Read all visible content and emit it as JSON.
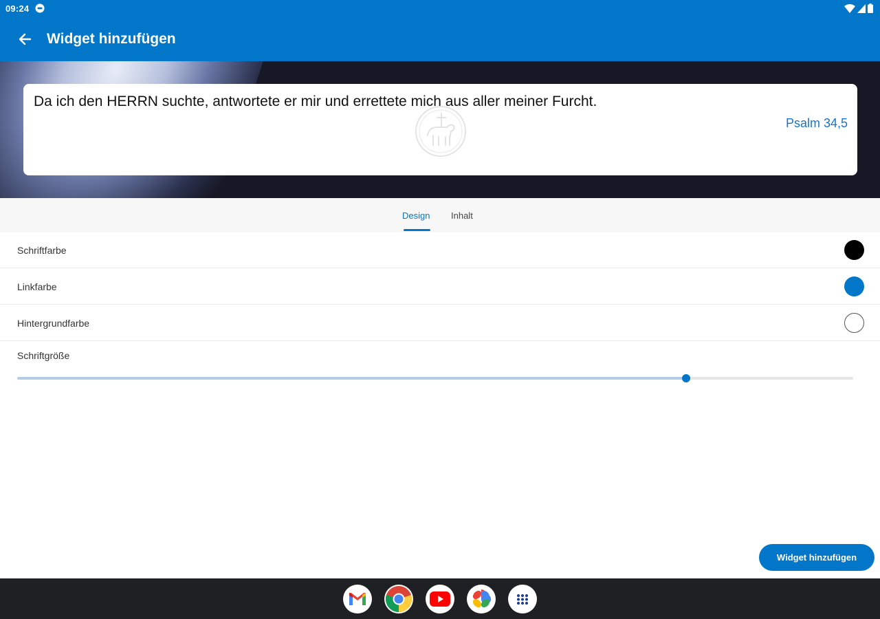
{
  "status_bar": {
    "time": "09:24",
    "icons": [
      "dnd-icon",
      "wifi-icon",
      "signal-icon",
      "battery-icon"
    ]
  },
  "app_bar": {
    "title": "Widget hinzufügen",
    "back_icon": "arrow-back-icon"
  },
  "preview": {
    "verse_text": "Da ich den HERRN suchte, antwortete er mir und errettete mich aus aller meiner Furcht.",
    "verse_reference": "Psalm 34,5",
    "watermark_icon": "lamb-seal-icon"
  },
  "tabs": [
    {
      "label": "Design",
      "selected": true
    },
    {
      "label": "Inhalt",
      "selected": false
    }
  ],
  "settings": [
    {
      "label": "Schriftfarbe",
      "color": "#000000"
    },
    {
      "label": "Linkfarbe",
      "color": "#0277c9"
    },
    {
      "label": "Hintergrundfarbe",
      "color": "#ffffff"
    }
  ],
  "font_size": {
    "label": "Schriftgröße",
    "value_fraction": 0.8
  },
  "add_button": {
    "label": "Widget hinzufügen"
  },
  "taskbar": {
    "apps": [
      "gmail-icon",
      "chrome-icon",
      "youtube-icon",
      "photos-icon",
      "app-drawer-icon"
    ]
  },
  "colors": {
    "accent": "#0277c9",
    "link": "#1a73c9",
    "preview_background": "#171826",
    "taskbar": "#1f2024"
  }
}
